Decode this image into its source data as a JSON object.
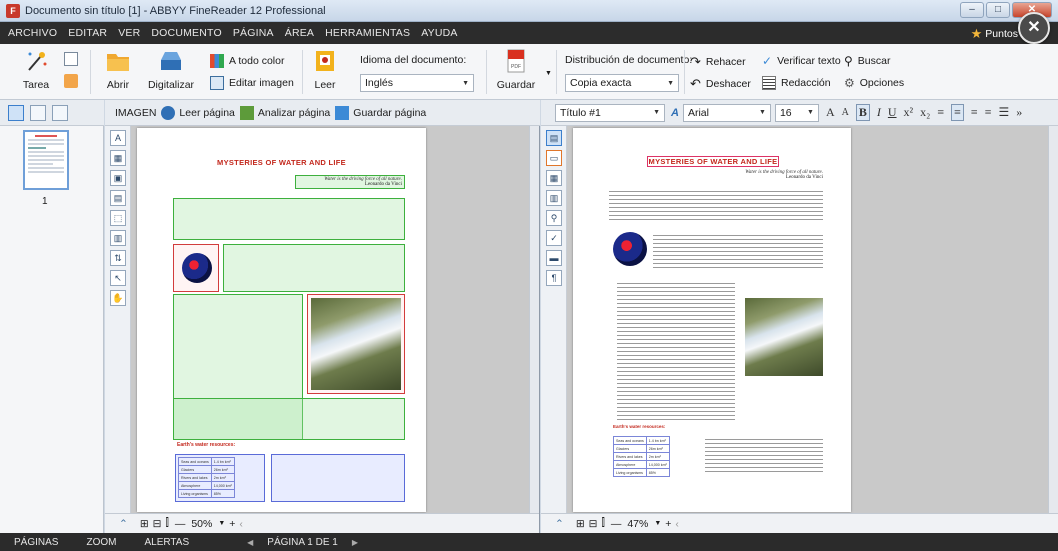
{
  "window": {
    "title": "Documento sin título [1] - ABBYY FineReader 12 Professional",
    "controls": [
      "–",
      "□",
      "✕"
    ]
  },
  "menu": {
    "items": [
      "ARCHIVO",
      "EDITAR",
      "VER",
      "DOCUMENTO",
      "PÁGINA",
      "ÁREA",
      "HERRAMIENTAS",
      "AYUDA"
    ],
    "account_label": "Puntos"
  },
  "ribbon": {
    "tarea": "Tarea",
    "abrir": "Abrir",
    "digitalizar": "Digitalizar",
    "a_todo_color": "A todo color",
    "editar_imagen": "Editar imagen",
    "leer": "Leer",
    "idioma_label": "Idioma del documento:",
    "idioma_value": "Inglés",
    "guardar": "Guardar",
    "distribucion_label": "Distribución de documento:",
    "distribucion_value": "Copia exacta",
    "rehacer": "Rehacer",
    "deshacer": "Deshacer",
    "verificar_texto": "Verificar texto",
    "redaccion": "Redacción",
    "buscar": "Buscar",
    "opciones": "Opciones"
  },
  "image_toolbar": {
    "label": "IMAGEN",
    "leer_pagina": "Leer página",
    "analizar_pagina": "Analizar página",
    "guardar_pagina": "Guardar página"
  },
  "text_toolbar": {
    "style_value": "Título #1",
    "font_value": "Arial",
    "size_value": "16",
    "buttons": [
      "A",
      "A",
      "B",
      "I",
      "U",
      "x²",
      "x₂"
    ]
  },
  "pages_pane": {
    "page_number": "1"
  },
  "image_pane": {
    "zoom_value": "50%"
  },
  "text_pane": {
    "zoom_value": "47%"
  },
  "document": {
    "title": "MYSTERIES OF WATER AND LIFE",
    "quote": "Water is the driving force of all nature.",
    "quote_author": "Leonardo da Vinci",
    "section_label": "Earth's water resources:",
    "table_rows": [
      [
        "Seas and oceans",
        "1.4 bn km³"
      ],
      [
        "Glaciers",
        "26m km³"
      ],
      [
        "Rivers and lakes",
        "2m km³"
      ],
      [
        "Atmosphere",
        "14,000 km³"
      ],
      [
        "Living organisms",
        "85%"
      ]
    ]
  },
  "statusbar": {
    "items": [
      "PÁGINAS",
      "ZOOM",
      "ALERTAS"
    ],
    "page_indicator": "PÁGINA 1 DE 1"
  },
  "colors": {
    "menu_bg": "#2c2c2c",
    "title_red": "#c3281d",
    "accent_blue": "#6f9fd8"
  }
}
